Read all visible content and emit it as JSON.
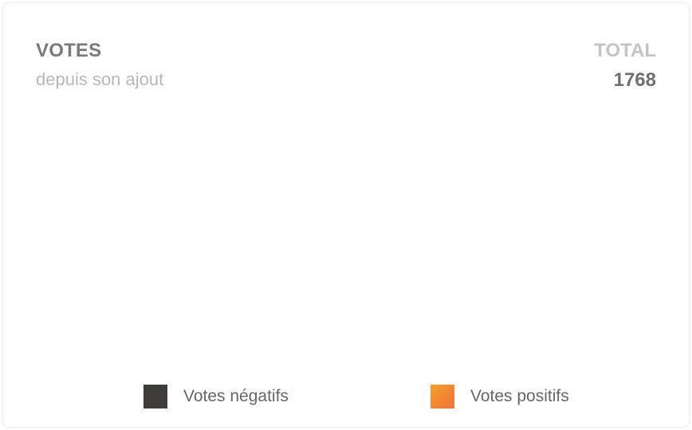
{
  "card": {
    "title": "VOTES",
    "subtitle": "depuis son ajout",
    "total_label": "TOTAL",
    "total_value": "1768"
  },
  "legend": {
    "items": [
      {
        "label": "Votes négatifs",
        "color": "#3d3c3a"
      },
      {
        "label": "Votes positifs",
        "color": "#f39a2e"
      }
    ]
  }
}
